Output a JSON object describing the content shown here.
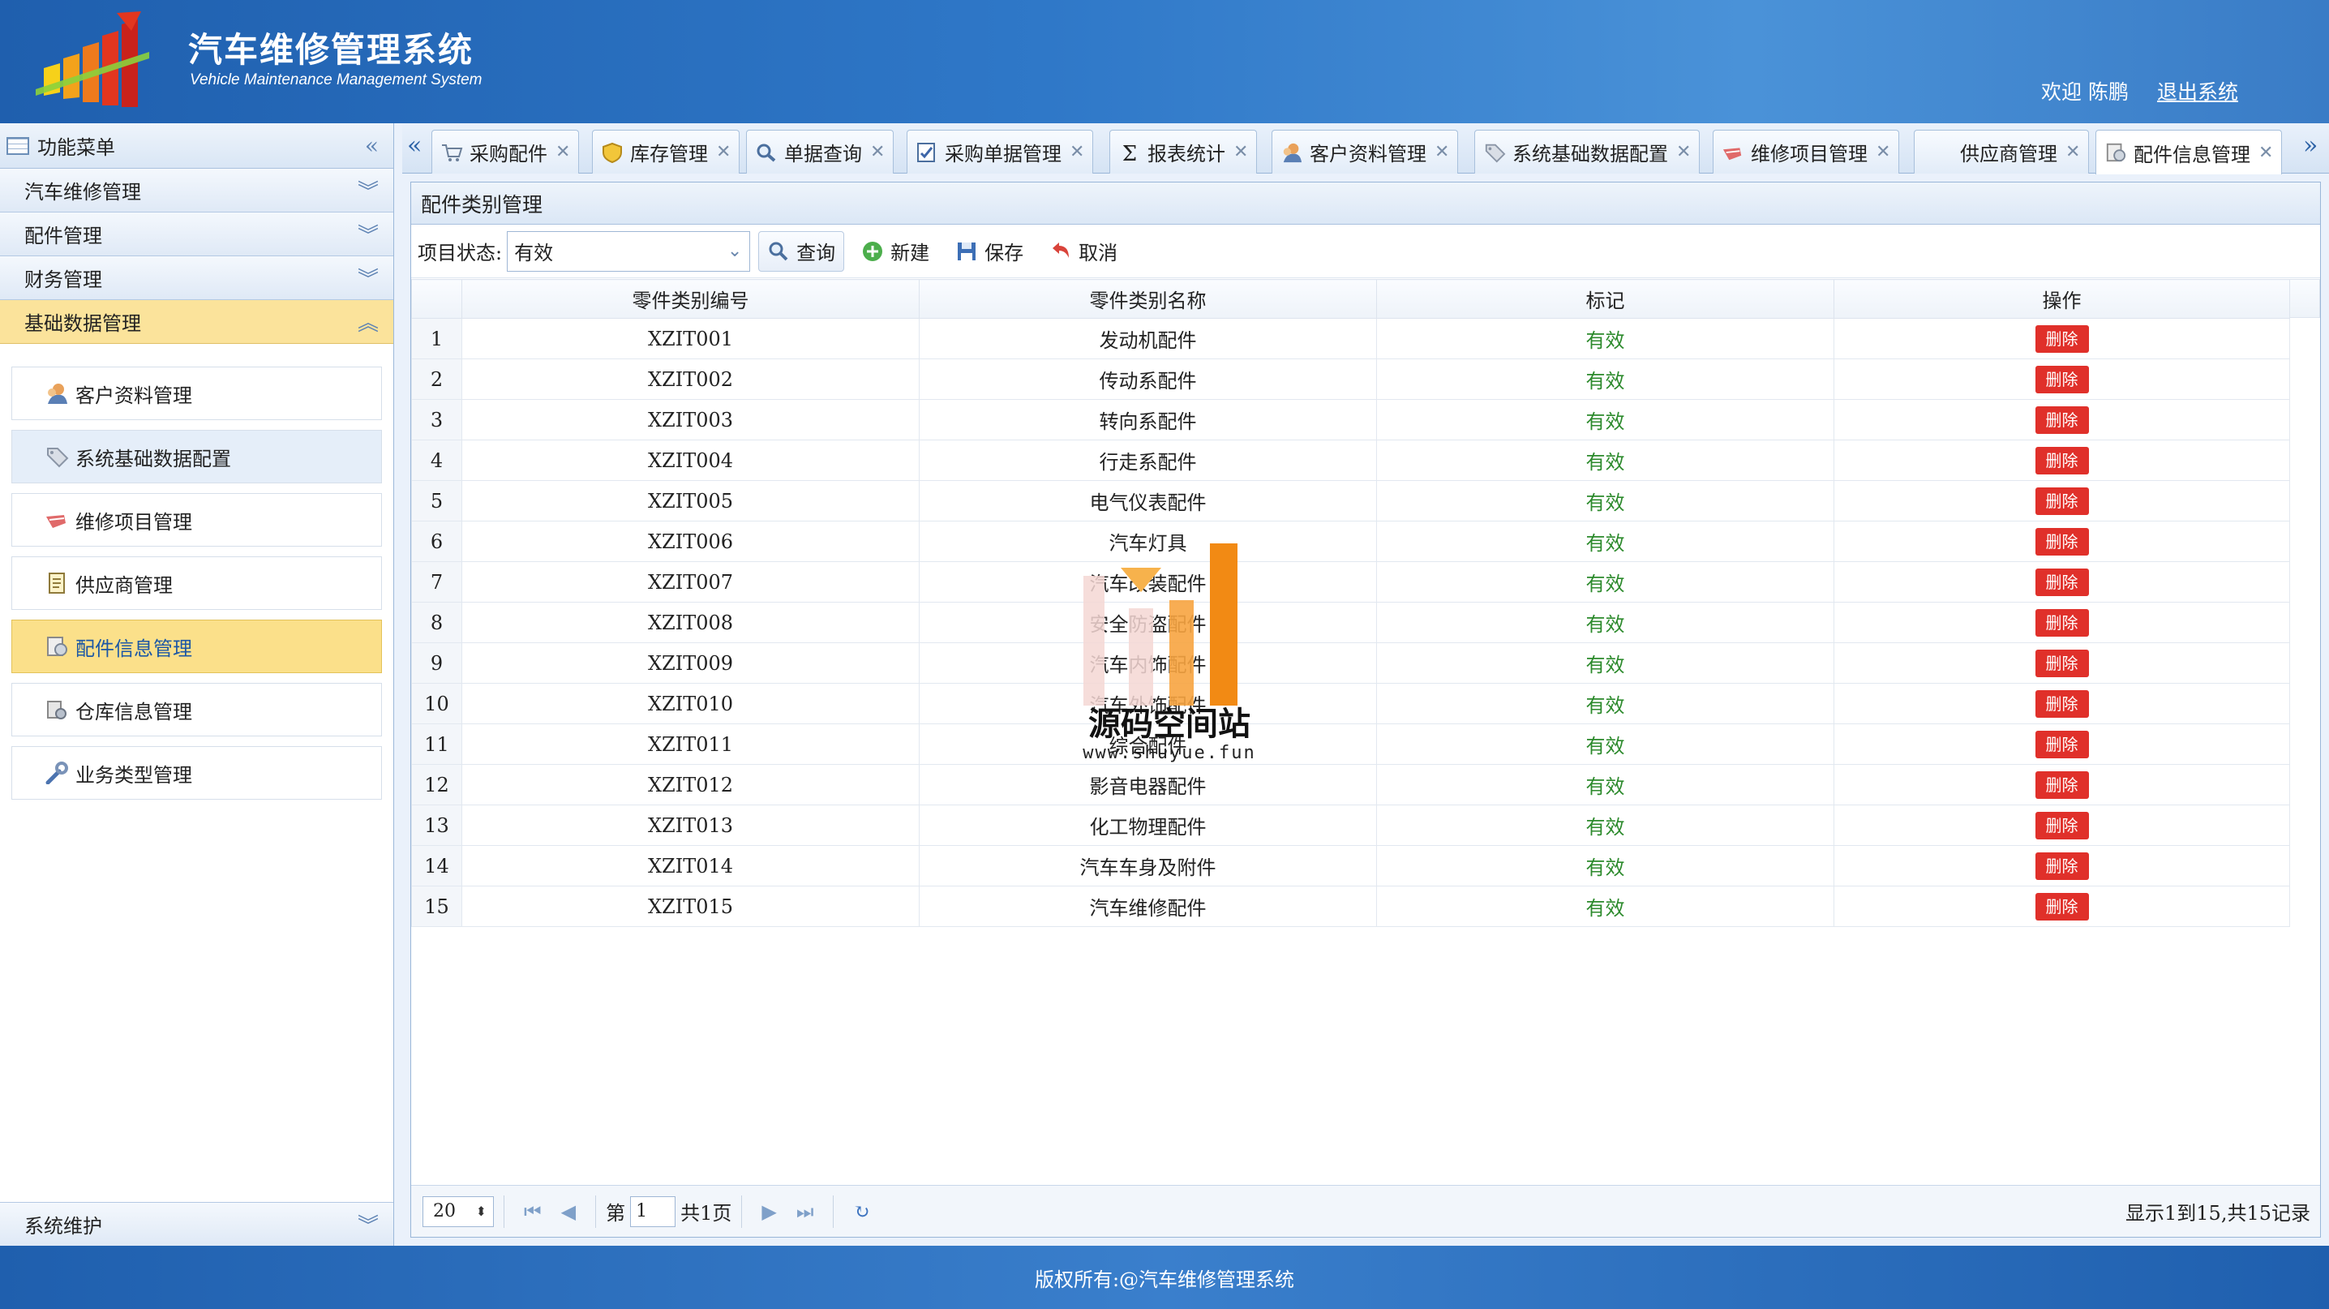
{
  "header": {
    "title": "汽车维修管理系统",
    "subtitle": "Vehicle Maintenance Management System",
    "welcome": "欢迎 陈鹏",
    "logout": "退出系统"
  },
  "sidebar": {
    "title": "功能菜单",
    "groups": [
      {
        "label": "汽车维修管理"
      },
      {
        "label": "配件管理"
      },
      {
        "label": "财务管理"
      },
      {
        "label": "基础数据管理"
      }
    ],
    "items": [
      {
        "label": "客户资料管理",
        "icon": "customer-icon"
      },
      {
        "label": "系统基础数据配置",
        "icon": "tag-icon"
      },
      {
        "label": "维修项目管理",
        "icon": "repair-icon"
      },
      {
        "label": "供应商管理",
        "icon": "document-icon"
      },
      {
        "label": "配件信息管理",
        "icon": "parts-icon"
      },
      {
        "label": "仓库信息管理",
        "icon": "warehouse-icon"
      },
      {
        "label": "业务类型管理",
        "icon": "wrench-icon"
      }
    ],
    "bottom": "系统维护"
  },
  "tabs": [
    {
      "label": "采购配件",
      "icon": "cart-icon"
    },
    {
      "label": "库存管理",
      "icon": "shield-icon"
    },
    {
      "label": "单据查询",
      "icon": "search-icon"
    },
    {
      "label": "采购单据管理",
      "icon": "form-icon"
    },
    {
      "label": "报表统计",
      "icon": "sigma-icon"
    },
    {
      "label": "客户资料管理",
      "icon": "customer-icon"
    },
    {
      "label": "系统基础数据配置",
      "icon": "tag-icon"
    },
    {
      "label": "维修项目管理",
      "icon": "repair-icon"
    },
    {
      "label": "供应商管理",
      "icon": "none"
    },
    {
      "label": "配件信息管理",
      "icon": "parts-icon"
    }
  ],
  "panel": {
    "title": "配件类别管理",
    "filter_label": "项目状态:",
    "filter_value": "有效",
    "query": "查询",
    "new": "新建",
    "save": "保存",
    "cancel": "取消"
  },
  "table": {
    "columns": [
      "零件类别编号",
      "零件类别名称",
      "标记",
      "操作"
    ],
    "delete_label": "删除",
    "rows": [
      {
        "no": "1",
        "code": "XZIT001",
        "name": "发动机配件",
        "flag": "有效"
      },
      {
        "no": "2",
        "code": "XZIT002",
        "name": "传动系配件",
        "flag": "有效"
      },
      {
        "no": "3",
        "code": "XZIT003",
        "name": "转向系配件",
        "flag": "有效"
      },
      {
        "no": "4",
        "code": "XZIT004",
        "name": "行走系配件",
        "flag": "有效"
      },
      {
        "no": "5",
        "code": "XZIT005",
        "name": "电气仪表配件",
        "flag": "有效"
      },
      {
        "no": "6",
        "code": "XZIT006",
        "name": "汽车灯具",
        "flag": "有效"
      },
      {
        "no": "7",
        "code": "XZIT007",
        "name": "汽车改装配件",
        "flag": "有效"
      },
      {
        "no": "8",
        "code": "XZIT008",
        "name": "安全防盗配件",
        "flag": "有效"
      },
      {
        "no": "9",
        "code": "XZIT009",
        "name": "汽车内饰配件",
        "flag": "有效"
      },
      {
        "no": "10",
        "code": "XZIT010",
        "name": "汽车外饰配件",
        "flag": "有效"
      },
      {
        "no": "11",
        "code": "XZIT011",
        "name": "综合配件",
        "flag": "有效"
      },
      {
        "no": "12",
        "code": "XZIT012",
        "name": "影音电器配件",
        "flag": "有效"
      },
      {
        "no": "13",
        "code": "XZIT013",
        "name": "化工物理配件",
        "flag": "有效"
      },
      {
        "no": "14",
        "code": "XZIT014",
        "name": "汽车车身及附件",
        "flag": "有效"
      },
      {
        "no": "15",
        "code": "XZIT015",
        "name": "汽车维修配件",
        "flag": "有效"
      }
    ]
  },
  "pager": {
    "page_size": "20",
    "page_prefix": "第",
    "page_value": "1",
    "page_total": "共1页",
    "info": "显示1到15,共15记录"
  },
  "watermark": {
    "name": "源码空间站",
    "url": "www.shuyue.fun"
  },
  "footer": "版权所有:@汽车维修管理系统",
  "colors": {
    "header_blue": "#2f78c8",
    "active_yellow": "#fbe08a",
    "valid_green": "#2c8a2c",
    "delete_red": "#e0302a"
  }
}
